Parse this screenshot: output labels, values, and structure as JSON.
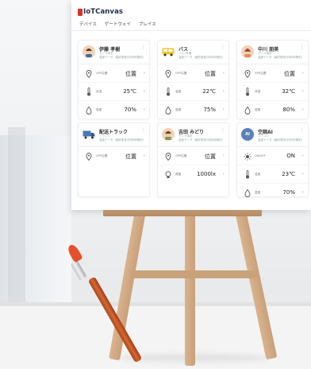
{
  "app": {
    "logo_text": "IoTCanvas",
    "brand_color": "#d6342b"
  },
  "tabs": [
    "デバイス",
    "ゲートウェイ",
    "プレイス"
  ],
  "cards": [
    {
      "name": "伊藤 孝樹",
      "sub1": "センサ端末",
      "sub2": "温度データ（最終更新日時8時間前）",
      "avatar": "person",
      "rows": [
        {
          "icon": "location-icon",
          "label": "GPS位置",
          "value": "位置"
        },
        {
          "icon": "thermometer-icon",
          "label": "気温",
          "value": "25℃"
        },
        {
          "icon": "drop-icon",
          "label": "湿度",
          "value": "70%"
        }
      ]
    },
    {
      "name": "バス",
      "sub1": "バス1号車",
      "sub2": "温度データ（最終更新日時8時間前）",
      "avatar": "bus",
      "rows": [
        {
          "icon": "location-icon",
          "label": "GPS位置",
          "value": "位置"
        },
        {
          "icon": "thermometer-icon",
          "label": "温度",
          "value": "22℃"
        },
        {
          "icon": "drop-icon",
          "label": "湿度",
          "value": "75%"
        }
      ]
    },
    {
      "name": "中川 朋美",
      "sub1": "センサ端末",
      "sub2": "温度データ（最終更新日時8時間前）",
      "avatar": "person",
      "rows": [
        {
          "icon": "location-icon",
          "label": "GPS位置",
          "value": "位置"
        },
        {
          "icon": "thermometer-icon",
          "label": "体温",
          "value": "32℃"
        },
        {
          "icon": "drop-icon",
          "label": "湿度",
          "value": "80%"
        }
      ]
    },
    {
      "name": "配送トラック",
      "sub1": "トラック",
      "sub2": "温度データ（最終更新日時8時間前）",
      "avatar": "truck",
      "rows": [
        {
          "icon": "location-icon",
          "label": "GPS位置",
          "value": "位置"
        }
      ]
    },
    {
      "name": "吉田 みどり",
      "sub1": "センサ端末",
      "sub2": "温度データ（最終更新日時8時間前）",
      "avatar": "person",
      "rows": [
        {
          "icon": "location-icon",
          "label": "GPS位置",
          "value": "位置"
        },
        {
          "icon": "bulb-icon",
          "label": "照度",
          "value": "1000lx"
        }
      ]
    },
    {
      "name": "空調AI",
      "sub1": "エアコン",
      "sub2": "温度データ（最終更新日時8時間前）",
      "avatar": "ai",
      "avatar_text": "AI",
      "rows": [
        {
          "icon": "sun-icon",
          "label": "ON/OFF",
          "value": "ON"
        },
        {
          "icon": "thermometer-icon",
          "label": "温度",
          "value": "23℃"
        },
        {
          "icon": "drop-icon",
          "label": "湿度",
          "value": "70%"
        }
      ]
    }
  ],
  "chevron": "›",
  "kebab": "⋮"
}
